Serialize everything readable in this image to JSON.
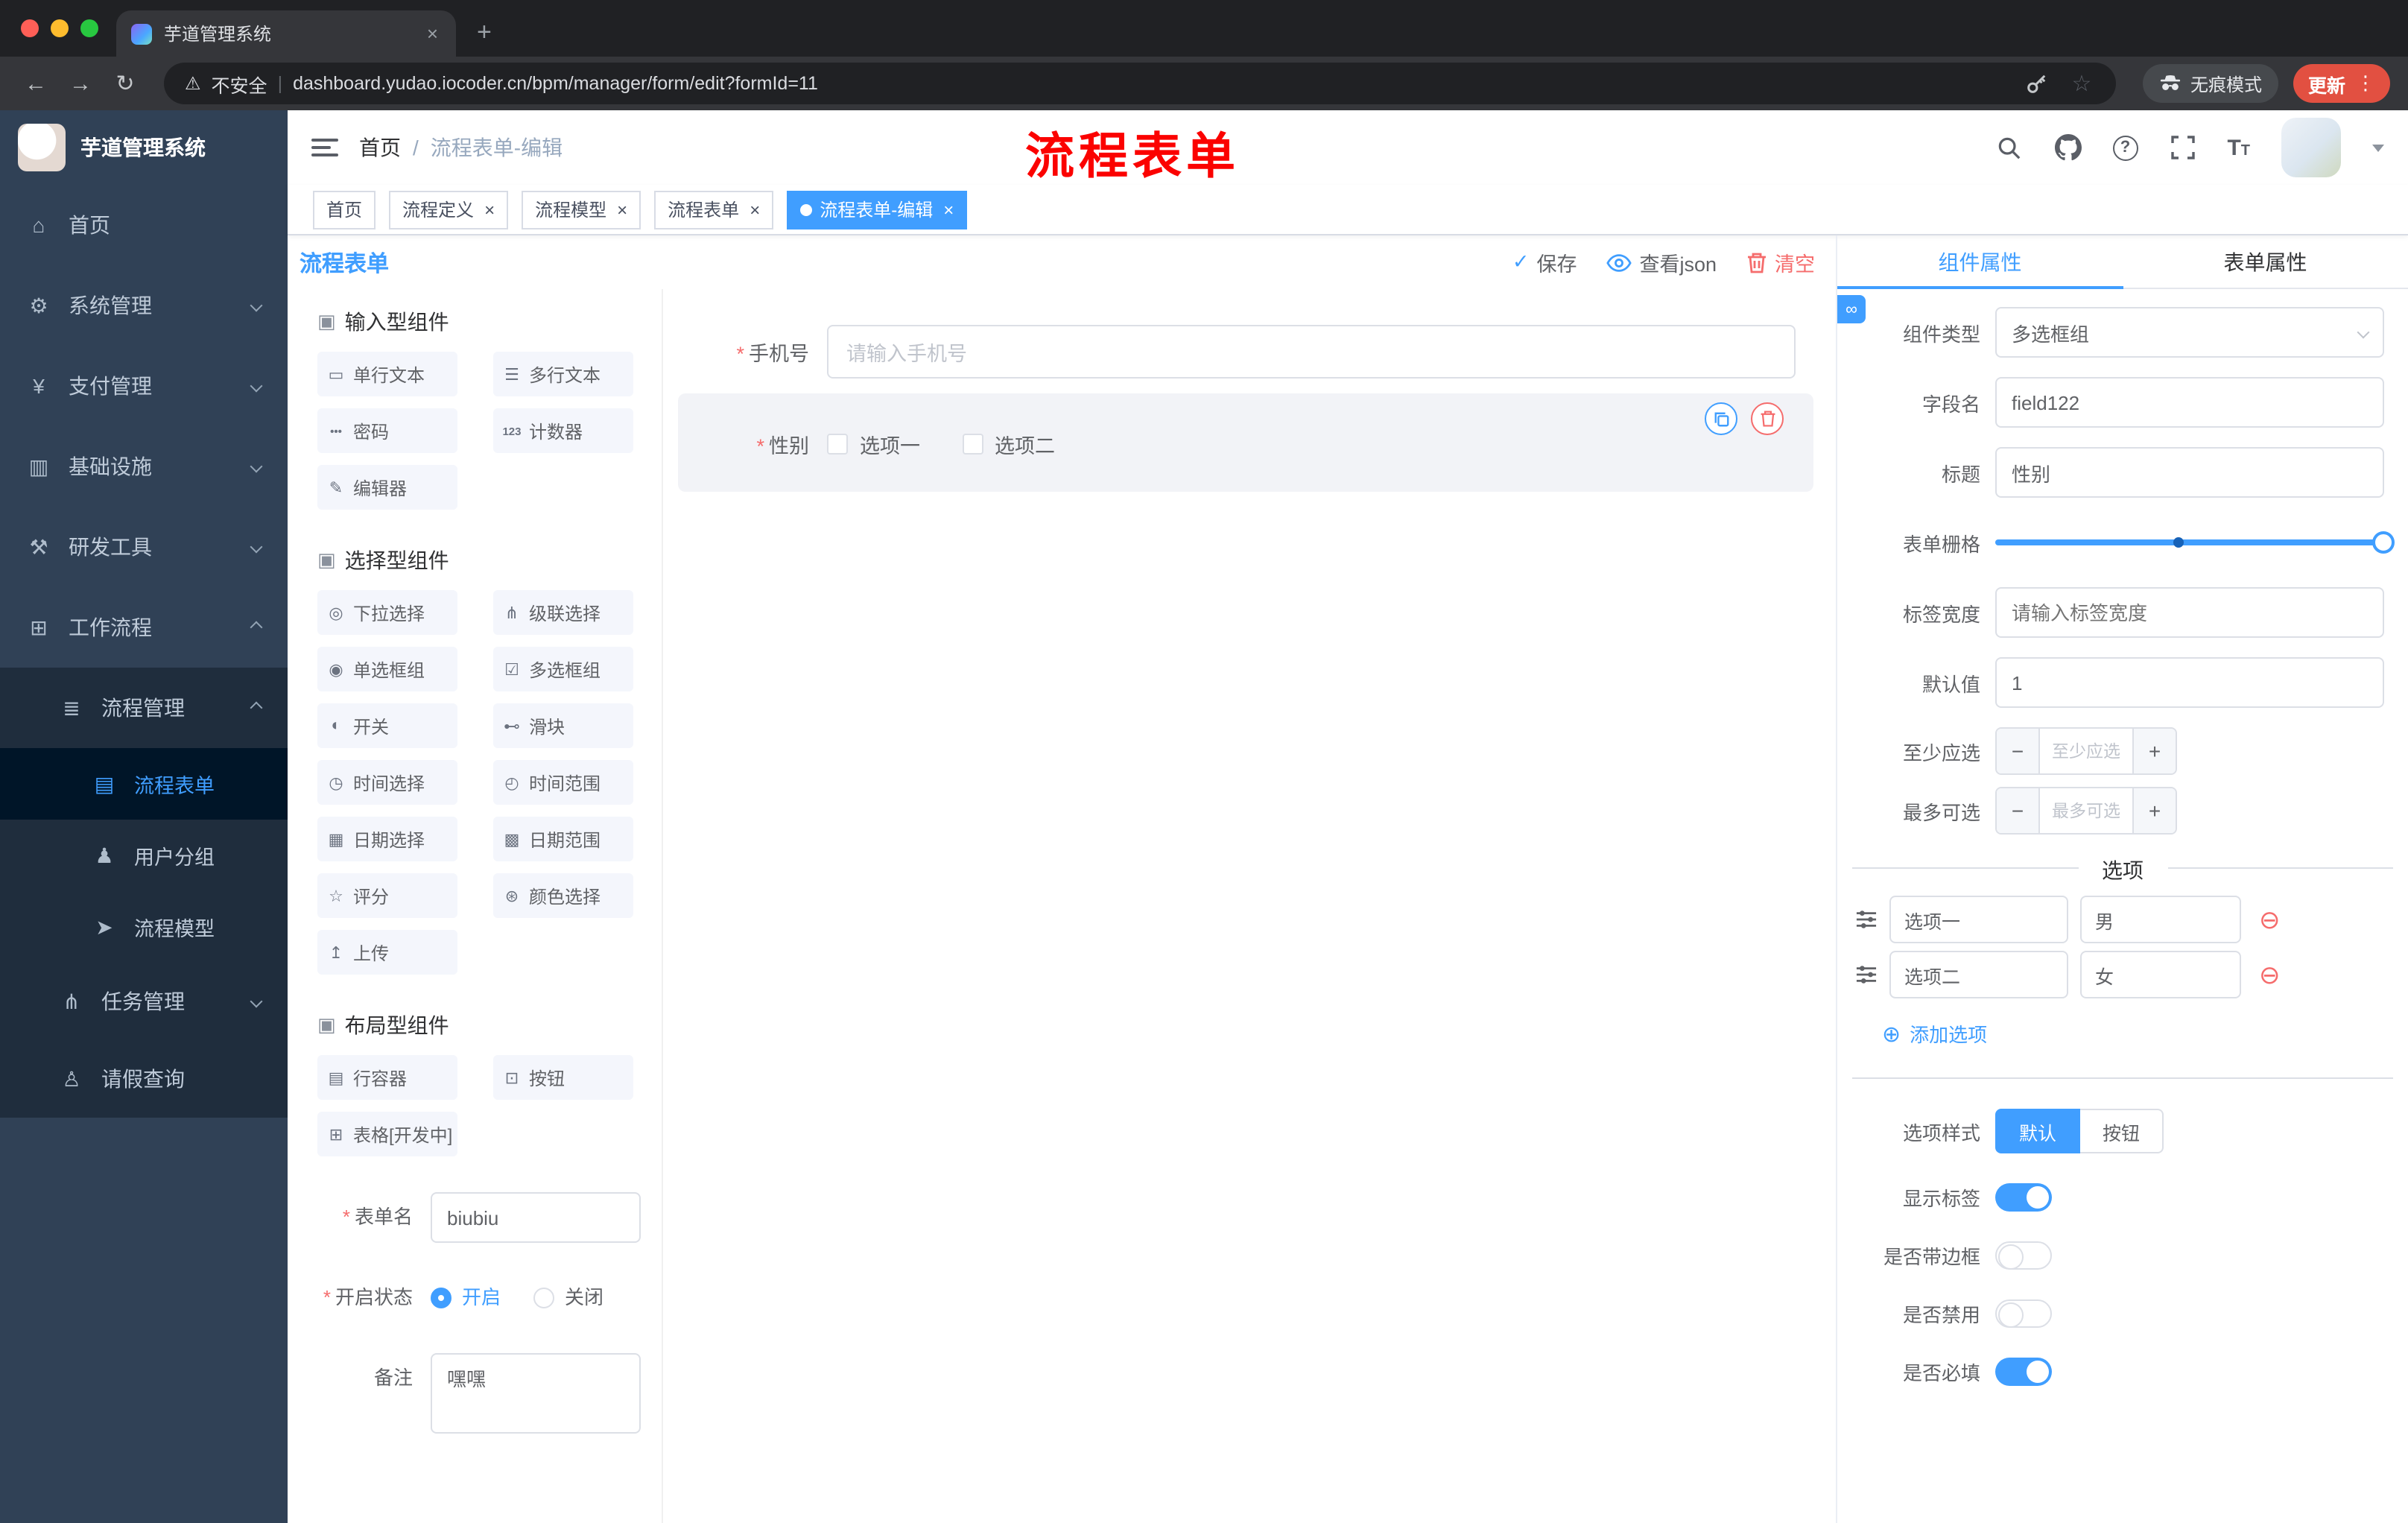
{
  "browser": {
    "tab_title": "芋道管理系统",
    "security_label": "不安全",
    "url": "dashboard.yudao.iocoder.cn/bpm/manager/form/edit?formId=11",
    "incognito_label": "无痕模式",
    "update_label": "更新"
  },
  "annotation": {
    "text": "流程表单",
    "color": "#ff0000"
  },
  "sidebar": {
    "title": "芋道管理系统",
    "items": [
      {
        "label": "首页"
      },
      {
        "label": "系统管理"
      },
      {
        "label": "支付管理"
      },
      {
        "label": "基础设施"
      },
      {
        "label": "研发工具"
      },
      {
        "label": "工作流程"
      },
      {
        "label": "流程管理"
      },
      {
        "label": "流程表单"
      },
      {
        "label": "用户分组"
      },
      {
        "label": "流程模型"
      },
      {
        "label": "任务管理"
      },
      {
        "label": "请假查询"
      }
    ]
  },
  "header": {
    "breadcrumb_home": "首页",
    "breadcrumb_current": "流程表单-编辑"
  },
  "tags": [
    {
      "label": "首页"
    },
    {
      "label": "流程定义"
    },
    {
      "label": "流程模型"
    },
    {
      "label": "流程表单"
    },
    {
      "label": "流程表单-编辑"
    }
  ],
  "designer": {
    "title": "流程表单",
    "actions": {
      "save": "保存",
      "view_json": "查看json",
      "clear": "清空"
    },
    "sections": [
      {
        "title": "输入型组件",
        "items": [
          "单行文本",
          "多行文本",
          "密码",
          "计数器",
          "编辑器"
        ]
      },
      {
        "title": "选择型组件",
        "items": [
          "下拉选择",
          "级联选择",
          "单选框组",
          "多选框组",
          "开关",
          "滑块",
          "时间选择",
          "时间范围",
          "日期选择",
          "日期范围",
          "评分",
          "颜色选择",
          "上传"
        ]
      },
      {
        "title": "布局型组件",
        "items": [
          "行容器",
          "按钮",
          "表格[开发中]"
        ]
      }
    ],
    "form": {
      "name_label": "表单名",
      "name_value": "biubiu",
      "status_label": "开启状态",
      "status_on": "开启",
      "status_off": "关闭",
      "remark_label": "备注",
      "remark_value": "嘿嘿"
    }
  },
  "canvas": {
    "phone_label": "手机号",
    "phone_placeholder": "请输入手机号",
    "gender_label": "性别",
    "gender_option1": "选项一",
    "gender_option2": "选项二"
  },
  "props": {
    "tab_component": "组件属性",
    "tab_form": "表单属性",
    "rows": {
      "type_label": "组件类型",
      "type_value": "多选框组",
      "field_label": "字段名",
      "field_value": "field122",
      "title_label": "标题",
      "title_value": "性别",
      "grid_label": "表单栅格",
      "label_width_label": "标签宽度",
      "label_width_placeholder": "请输入标签宽度",
      "default_label": "默认值",
      "default_value": "1",
      "min_label": "至少应选",
      "min_placeholder": "至少应选",
      "max_label": "最多可选",
      "max_placeholder": "最多可选"
    },
    "options_title": "选项",
    "options": [
      {
        "name": "选项一",
        "value": "男"
      },
      {
        "name": "选项二",
        "value": "女"
      }
    ],
    "add_option": "添加选项",
    "style_label": "选项样式",
    "style_default": "默认",
    "style_button": "按钮",
    "switch_rows": [
      {
        "label": "显示标签"
      },
      {
        "label": "是否带边框"
      },
      {
        "label": "是否禁用"
      },
      {
        "label": "是否必填"
      }
    ],
    "colors": {
      "accent": "#409eff",
      "danger": "#f56c6c"
    }
  }
}
